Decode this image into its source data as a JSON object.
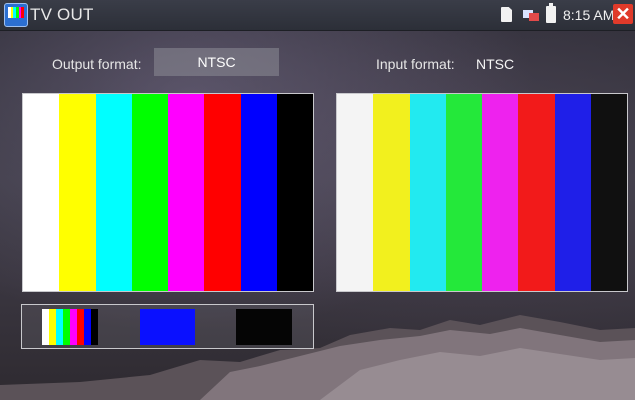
{
  "status_bar": {
    "title": "TV OUT",
    "time": "8:15 AM",
    "icons": [
      "app-icon",
      "sd-card-icon",
      "network-icon",
      "battery-icon",
      "close-icon"
    ],
    "close_glyph": "✕",
    "close_color": "#e03a2a"
  },
  "output": {
    "label": "Output format:",
    "value": "NTSC"
  },
  "input": {
    "label": "Input format:",
    "value": "NTSC"
  },
  "colors": {
    "output_bars": [
      "#ffffff",
      "#ffff00",
      "#00ffff",
      "#00ff00",
      "#ff00ff",
      "#ff0000",
      "#0000ff",
      "#000000"
    ],
    "input_bars": [
      "#f4f4f4",
      "#f2f01e",
      "#22eaf0",
      "#24e83a",
      "#ee22ee",
      "#f21a1a",
      "#1f1fe8",
      "#101010"
    ],
    "blue_block": "#0a10ff",
    "black_block": "#050505"
  }
}
